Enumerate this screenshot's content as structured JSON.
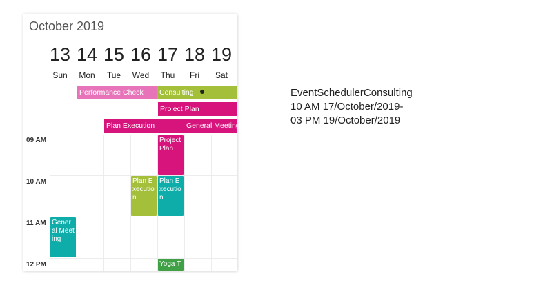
{
  "scheduler": {
    "month_title": "October 2019",
    "days": [
      {
        "num": "13",
        "name": "Sun"
      },
      {
        "num": "14",
        "name": "Mon"
      },
      {
        "num": "15",
        "name": "Tue"
      },
      {
        "num": "16",
        "name": "Wed"
      },
      {
        "num": "17",
        "name": "Thu"
      },
      {
        "num": "18",
        "name": "Fri"
      },
      {
        "num": "19",
        "name": "Sat"
      }
    ],
    "allday_events": [
      {
        "label": "Performance Check",
        "color": "#e774b9"
      },
      {
        "label": "Consulting",
        "color": "#a4c03b"
      },
      {
        "label": "Project Plan",
        "color": "#d6147b"
      },
      {
        "label": "Plan Execution",
        "color": "#d6147b"
      },
      {
        "label": "General Meeting",
        "color": "#d6147b"
      }
    ],
    "time_labels": [
      "09 AM",
      "10 AM",
      "11 AM",
      "12 PM"
    ],
    "appointments": [
      {
        "label": "Project Plan",
        "color": "#d6147b"
      },
      {
        "label": "Plan Execution",
        "color": "#a4c03b"
      },
      {
        "label": "Plan Execution",
        "color": "#0fadaa"
      },
      {
        "label": "General Meeting",
        "color": "#0fadaa"
      },
      {
        "label": "Yoga T",
        "color": "#3fa046"
      }
    ]
  },
  "tooltip": {
    "line1": "EventSchedulerConsulting",
    "line2": "10 AM 17/October/2019-",
    "line3": "03 PM 19/October/2019"
  }
}
